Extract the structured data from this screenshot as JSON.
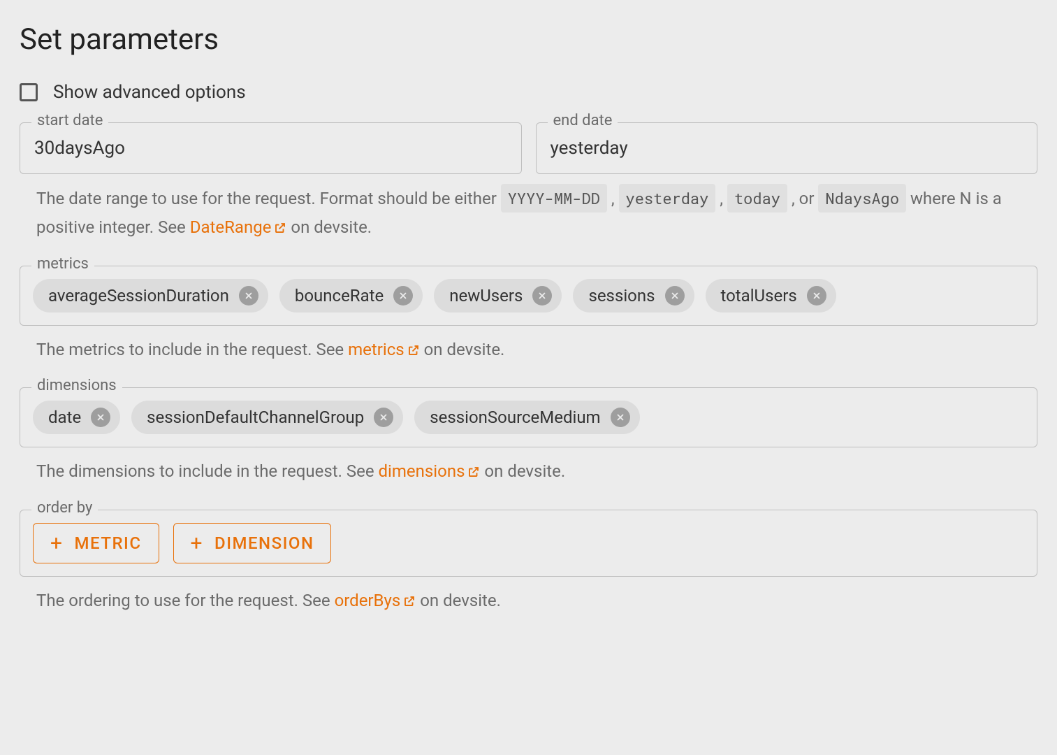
{
  "title": "Set parameters",
  "advanced": {
    "label": "Show advanced options",
    "checked": false
  },
  "dates": {
    "start_legend": "start date",
    "start_value": "30daysAgo",
    "end_legend": "end date",
    "end_value": "yesterday",
    "helper_pre": "The date range to use for the request. Format should be either ",
    "code1": "YYYY-MM-DD",
    "sep1": " , ",
    "code2": "yesterday",
    "sep2": " , ",
    "code3": "today",
    "sep3": " , or ",
    "code4": "NdaysAgo",
    "helper_mid": " where N is a positive integer. See ",
    "link_text": "DateRange",
    "helper_post": " on devsite."
  },
  "metrics": {
    "legend": "metrics",
    "chips": [
      "averageSessionDuration",
      "bounceRate",
      "newUsers",
      "sessions",
      "totalUsers"
    ],
    "helper_pre": "The metrics to include in the request. See ",
    "link_text": "metrics",
    "helper_post": " on devsite."
  },
  "dimensions": {
    "legend": "dimensions",
    "chips": [
      "date",
      "sessionDefaultChannelGroup",
      "sessionSourceMedium"
    ],
    "helper_pre": "The dimensions to include in the request. See ",
    "link_text": "dimensions",
    "helper_post": " on devsite."
  },
  "orderby": {
    "legend": "order by",
    "metric_btn": "METRIC",
    "dimension_btn": "DIMENSION",
    "helper_pre": "The ordering to use for the request. See ",
    "link_text": "orderBys",
    "helper_post": " on devsite."
  },
  "colors": {
    "accent": "#e8710a"
  }
}
